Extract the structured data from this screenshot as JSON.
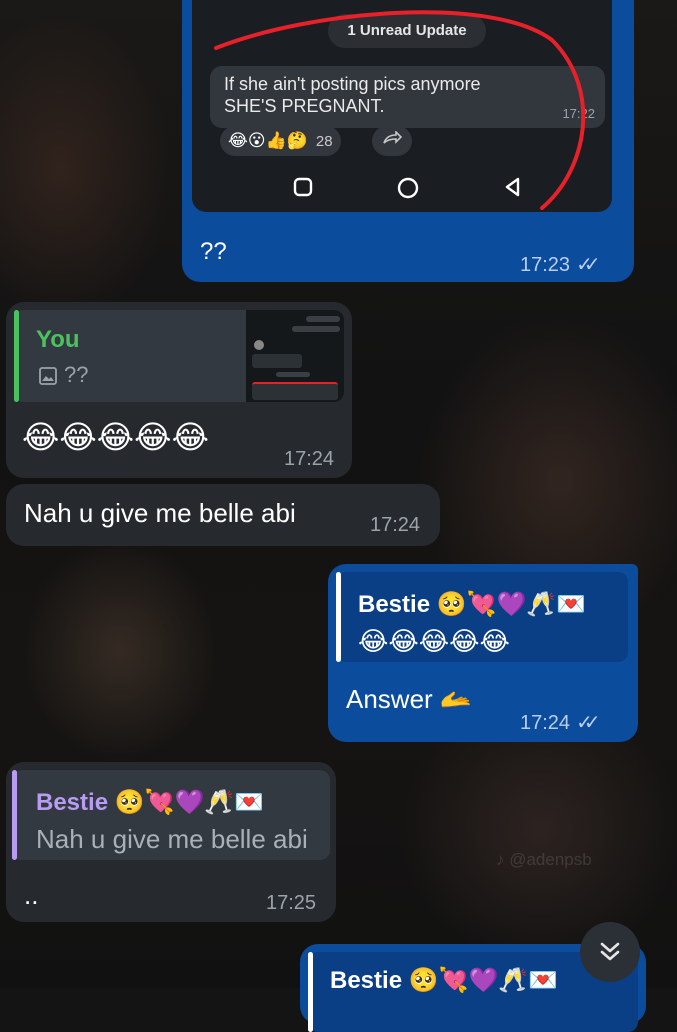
{
  "screenshot_bubble": {
    "unread_label": "1 Unread Update",
    "inner_message_line1": "If she ain't posting pics anymore",
    "inner_message_line2": "SHE'S PREGNANT.",
    "inner_time": "17:22",
    "reactions": "😂😮👍🤔",
    "reaction_count": "28",
    "forward_icon": "forward-icon",
    "caption": "??",
    "time": "17:23"
  },
  "reply_bubble_1": {
    "quote_name": "You",
    "quote_icon": "image-icon",
    "quote_text": "??",
    "body": "😂😂😂😂😂",
    "time": "17:24"
  },
  "message_2": {
    "text": "Nah u give me belle abi",
    "time": "17:24"
  },
  "reply_bubble_out": {
    "quote_name": "Bestie 🥺💘💜🥂💌",
    "quote_text": "😂😂😂😂😂",
    "body": "Answer 🫴",
    "time": "17:24"
  },
  "reply_bubble_in": {
    "quote_name": "Bestie 🥺💘💜🥂💌",
    "quote_text": "Nah u give me belle abi",
    "body": "..",
    "time": "17:25"
  },
  "partial_bubble": {
    "quote_name": "Bestie 🥺💘💜🥂💌"
  },
  "watermark": "♪ @adenpsb",
  "colors": {
    "outgoing_bubble": "#0c4c9c",
    "incoming_bubble": "#262a2e",
    "you_accent": "#4cc25f",
    "bestie_in_accent": "#b79cf2",
    "annotation_red": "#e8202a"
  }
}
